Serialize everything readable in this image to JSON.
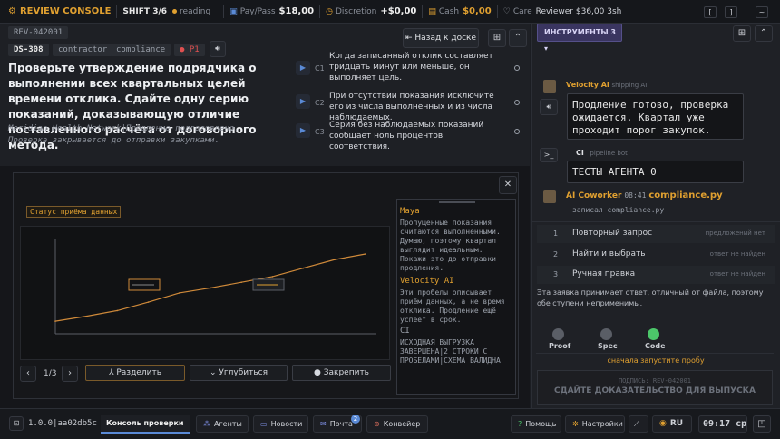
{
  "topbar": {
    "brand": "REVIEW CONSOLE",
    "shift": "SHIFT 3/6",
    "mode": "reading",
    "pay_label": "Pay/Pass",
    "pay_value": "$18,00",
    "discretion_label": "Discretion",
    "discretion_value": "+$0,00",
    "cash_label": "Cash",
    "cash_value": "$0,00",
    "care_label": "Care",
    "care_value": "Reviewer $36,00 3sh",
    "key_left": "[",
    "key_right": "]",
    "key_tilde": "~"
  },
  "ticket": {
    "id": "REV-042001",
    "tags": [
      "DS-308",
      "contractor",
      "compliance",
      "P1"
    ],
    "back_label": "Назад к доске",
    "question": "Проверьте утверждение подрядчика о выполнении всех квартальных целей времени отклика. Сдайте одну серию показаний, доказывающую отличие поставленного расчёта от договорного метода.",
    "source": "Meridian Health Network|Продление подготовлено. Проверка закрывается до отправки закупками.",
    "criteria": [
      {
        "label": "C1",
        "text": "Когда записанный отклик составляет тридцать минут или меньше, он выполняет цель."
      },
      {
        "label": "C2",
        "text": "При отсутствии показания исключите его из числа выполненных и из числа наблюдаемых."
      },
      {
        "label": "C3",
        "text": "Серия без наблюдаемых показаний сообщает ноль процентов соответствия."
      }
    ]
  },
  "modal": {
    "chart_title": "Статус приёма данных",
    "pager": "1/3",
    "split_label": "Разделить",
    "deepen_label": "Углубиться",
    "pin_label": "Закрепить",
    "notes": [
      {
        "author": "Maya",
        "text": "Пропущенные показания считаются выполненными. Думаю, поэтому квартал выглядит идеальным. Покажи это до отправки продления."
      },
      {
        "author": "Velocity AI",
        "text": "Эти пробелы описывает приём данных, а не время отклика. Продление ещё успеет в срок."
      },
      {
        "author": "CI",
        "text": "ИСХОДНАЯ ВЫГРУЗКА ЗАВЕРШЕНА|2 СТРОКИ С ПРОБЕЛАМИ|СХЕМА ВАЛИДНА"
      }
    ]
  },
  "chart_data": {
    "type": "line",
    "title": "Статус приёма данных",
    "x": [
      0,
      1,
      2,
      3,
      4,
      5,
      6,
      7,
      8,
      9,
      10
    ],
    "series": [
      {
        "values": [
          0.5,
          1.2,
          2.0,
          3.2,
          4.5,
          5.2,
          6.0,
          6.8,
          8.0,
          9.2,
          10.0
        ]
      }
    ],
    "annotations": [
      "",
      ""
    ],
    "grid": false
  },
  "tools": {
    "label": "ИНСТРУМЕНТЫ 3"
  },
  "chat": [
    {
      "author": "Velocity AI",
      "role": "shipping AI",
      "text": "Продление готово, проверка ожидается. Квартал уже проходит порог закупок."
    },
    {
      "author": "CI",
      "role": "pipeline bot",
      "text": "ТЕСТЫ АГЕНТА 0"
    },
    {
      "author": "AI Coworker",
      "time": "08:41",
      "file": "compliance.py",
      "text": "записал compliance.py"
    }
  ],
  "steps": [
    {
      "n": "1",
      "label": "Повторный запрос",
      "status": "предложений нет"
    },
    {
      "n": "2",
      "label": "Найти и выбрать",
      "status": "ответ не найден"
    },
    {
      "n": "3",
      "label": "Ручная правка",
      "status": "ответ не найден"
    }
  ],
  "status_note": "Эта заявка принимает ответ, отличный от файла, поэтому обе ступени неприменимы.",
  "gates": [
    {
      "label": "Proof",
      "color": "#5a5e66"
    },
    {
      "label": "Spec",
      "color": "#5a5e66"
    },
    {
      "label": "Code",
      "color": "#4cc76a"
    }
  ],
  "probe_hint": "сначала запустите пробу",
  "submit": {
    "sign": "ПОДПИСЬ: REV-042001",
    "label": "СДАЙТЕ ДОКАЗАТЕЛЬСТВО ДЛЯ ВЫПУСКА"
  },
  "bottombar": {
    "version": "1.0.0|aa02db5c",
    "console": "Консоль проверки",
    "agents": "Агенты",
    "news": "Новости",
    "mail": "Почта",
    "mail_badge": "2",
    "pipeline": "Конвейер",
    "help": "Помощь",
    "settings": "Настройки",
    "lang": "RU",
    "clock": "09:17 ср"
  }
}
